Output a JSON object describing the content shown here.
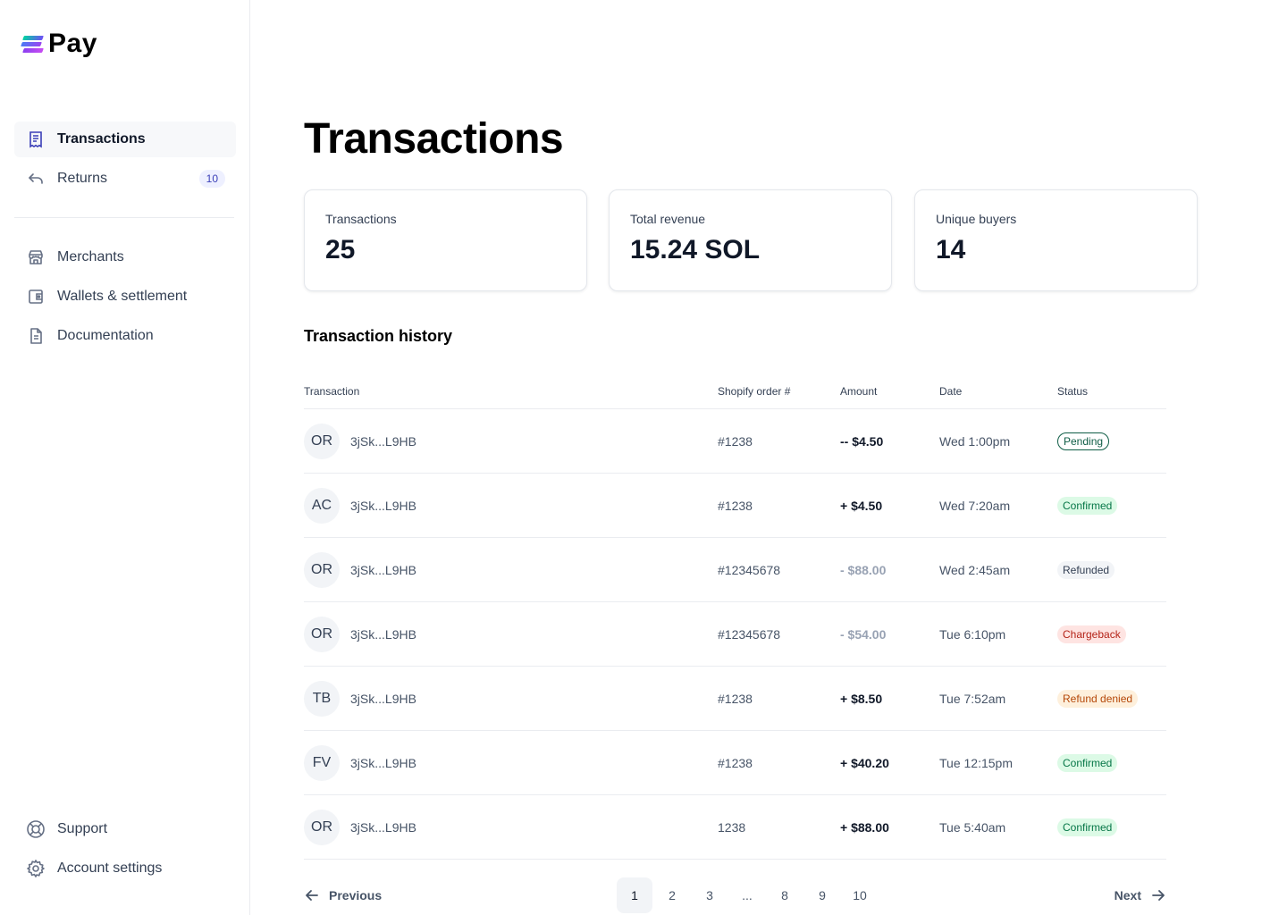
{
  "brand": {
    "name": "Pay"
  },
  "sidebar": {
    "primary": [
      {
        "label": "Transactions",
        "icon": "receipt-icon",
        "active": true
      },
      {
        "label": "Returns",
        "icon": "return-arrow-icon",
        "badge": "10"
      }
    ],
    "secondary": [
      {
        "label": "Merchants",
        "icon": "store-icon"
      },
      {
        "label": "Wallets & settlement",
        "icon": "wallet-icon"
      },
      {
        "label": "Documentation",
        "icon": "document-icon"
      }
    ],
    "footer": [
      {
        "label": "Support",
        "icon": "lifebuoy-icon"
      },
      {
        "label": "Account settings",
        "icon": "gear-icon"
      }
    ]
  },
  "page": {
    "title": "Transactions"
  },
  "stats": [
    {
      "label": "Transactions",
      "value": "25"
    },
    {
      "label": "Total revenue",
      "value": "15.24 SOL"
    },
    {
      "label": "Unique buyers",
      "value": "14"
    }
  ],
  "history": {
    "title": "Transaction history",
    "columns": [
      "Transaction",
      "Shopify order #",
      "Amount",
      "Date",
      "Status"
    ],
    "rows": [
      {
        "initials": "OR",
        "tx": "3jSk...L9HB",
        "order": "#1238",
        "amount": "-- $4.50",
        "date": "Wed 1:00pm",
        "status": "Pending"
      },
      {
        "initials": "AC",
        "tx": "3jSk...L9HB",
        "order": "#1238",
        "amount": "+ $4.50",
        "date": "Wed 7:20am",
        "status": "Confirmed"
      },
      {
        "initials": "OR",
        "tx": "3jSk...L9HB",
        "order": "#12345678",
        "amount": "- $88.00",
        "date": "Wed 2:45am",
        "status": "Refunded"
      },
      {
        "initials": "OR",
        "tx": "3jSk...L9HB",
        "order": "#12345678",
        "amount": "- $54.00",
        "date": "Tue 6:10pm",
        "status": "Chargeback"
      },
      {
        "initials": "TB",
        "tx": "3jSk...L9HB",
        "order": "#1238",
        "amount": "+ $8.50",
        "date": "Tue 7:52am",
        "status": "Refund denied"
      },
      {
        "initials": "FV",
        "tx": "3jSk...L9HB",
        "order": "#1238",
        "amount": "+ $40.20",
        "date": "Tue 12:15pm",
        "status": "Confirmed"
      },
      {
        "initials": "OR",
        "tx": "3jSk...L9HB",
        "order": "1238",
        "amount": "+ $88.00",
        "date": "Tue 5:40am",
        "status": "Confirmed"
      }
    ]
  },
  "pagination": {
    "previous": "Previous",
    "next": "Next",
    "pages": [
      "1",
      "2",
      "3",
      "...",
      "8",
      "9",
      "10"
    ],
    "current": "1"
  },
  "colors": {
    "accent": "#3b3fb8",
    "confirmed_bg": "#dcfae6",
    "confirmed_fg": "#067647",
    "chargeback_bg": "#fee4e2",
    "chargeback_fg": "#b42318",
    "denied_bg": "#fef0dc",
    "denied_fg": "#b54708",
    "pending_fg": "#0f5d46"
  }
}
